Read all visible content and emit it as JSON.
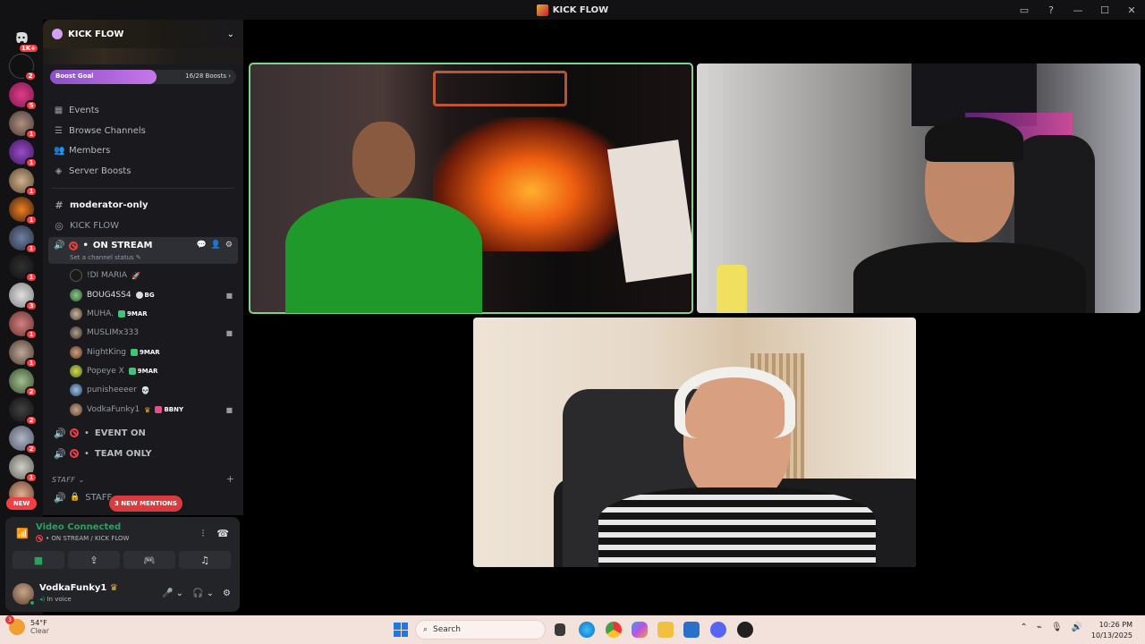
{
  "window": {
    "title": "KICK FLOW"
  },
  "rail": {
    "top_badge": "1K+",
    "badges": [
      "2",
      "5",
      "1",
      "1",
      "1",
      "1",
      "1",
      "1",
      "3",
      "1",
      "1",
      "2",
      "2",
      "2",
      "1"
    ],
    "new_label": "NEW"
  },
  "server": {
    "name": "KICK FLOW",
    "boost_goal_label": "Boost Goal",
    "boost_count": "16/28 Boosts",
    "boost_progress": 0.57
  },
  "nav": {
    "events": "Events",
    "browse_channels": "Browse Channels",
    "members": "Members",
    "server_boosts": "Server Boosts"
  },
  "channels": {
    "moderator_only": "moderator-only",
    "kick_flow": "KICK FLOW",
    "on_stream": "ON STREAM",
    "on_stream_prefix": "•",
    "set_status": "Set a channel status",
    "event_on": "EVENT ON",
    "team_only": "TEAM ONLY",
    "staff_category": "STAFF",
    "staff_channel": "STAFF"
  },
  "voice_users": [
    {
      "name": "!DI MARIA",
      "tag": ""
    },
    {
      "name": "BOUG4SS4",
      "tag": "BG"
    },
    {
      "name": "MUHA.",
      "tag": "9MAR"
    },
    {
      "name": "MUSLIMx333",
      "tag": ""
    },
    {
      "name": "NightKing",
      "tag": "9MAR"
    },
    {
      "name": "Popeye X",
      "tag": "9MAR"
    },
    {
      "name": "punisheeeer",
      "tag": ""
    },
    {
      "name": "VodkaFunky1",
      "tag": "BBNY"
    }
  ],
  "mentions": "3 NEW MENTIONS",
  "voice_panel": {
    "title": "Video Connected",
    "subtitle": "• ON STREAM / KICK FLOW"
  },
  "user": {
    "name": "VodkaFunky1",
    "status": "In voice"
  },
  "taskbar": {
    "weather_badge": "3",
    "temperature": "54°F",
    "condition": "Clear",
    "search_placeholder": "Search",
    "time": "10:26 PM",
    "date": "10/13/2025"
  },
  "colors": {
    "speaking_outline": "#7cd48c",
    "connected_green": "#23a55a",
    "badge_red": "#f23f43"
  }
}
